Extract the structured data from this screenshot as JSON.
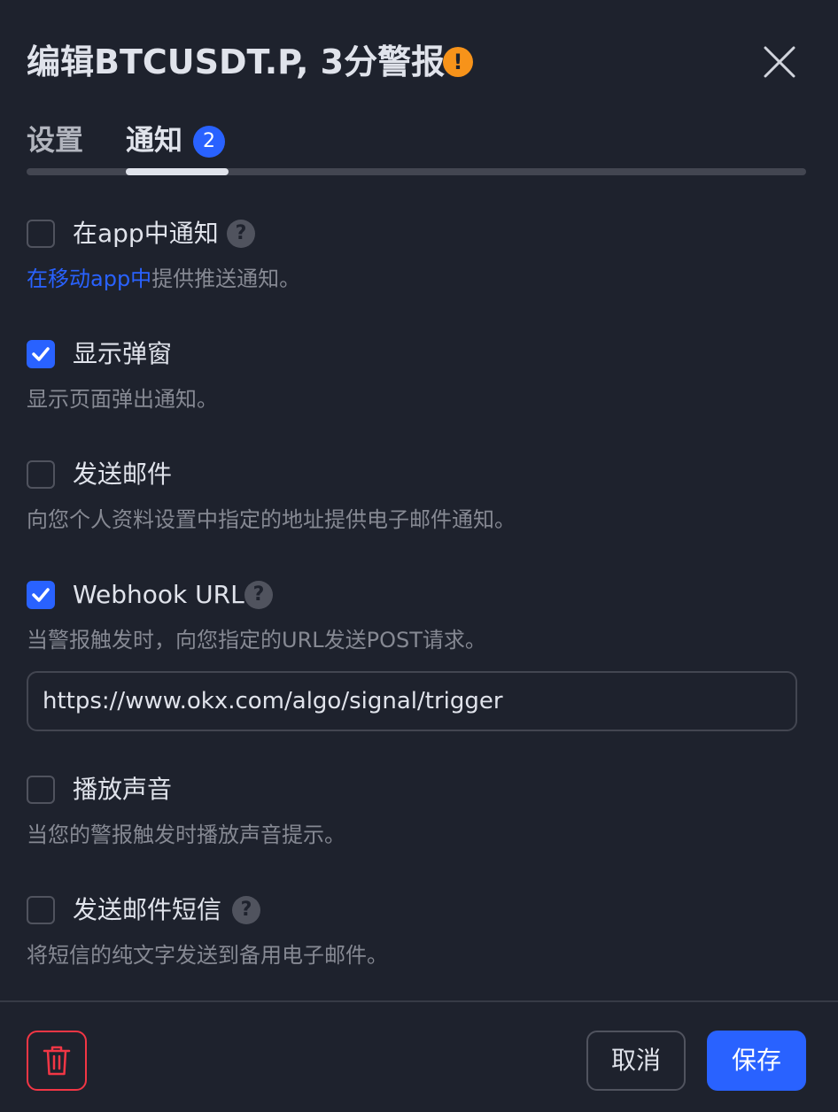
{
  "header": {
    "title": "编辑BTCUSDT.P, 3分警报",
    "warning_icon": "exclamation-circle-icon",
    "warning_glyph": "!",
    "warning_color": "#f7931a"
  },
  "tabs": [
    {
      "label": "设置",
      "active": false
    },
    {
      "label": "通知",
      "active": true,
      "badge": "2"
    }
  ],
  "options": [
    {
      "label": "在app中通知",
      "checked": false,
      "help": true,
      "desc_link": "在移动app中",
      "desc": "提供推送通知。"
    },
    {
      "label": "显示弹窗",
      "checked": true,
      "help": false,
      "desc": "显示页面弹出通知。"
    },
    {
      "label": "发送邮件",
      "checked": false,
      "help": false,
      "desc": "向您个人资料设置中指定的地址提供电子邮件通知。"
    },
    {
      "label": "Webhook URL",
      "checked": true,
      "help": true,
      "desc": "当警报触发时，向您指定的URL发送POST请求。"
    },
    {
      "label": "播放声音",
      "checked": false,
      "help": false,
      "desc": "当您的警报触发时播放声音提示。"
    },
    {
      "label": "发送邮件短信",
      "checked": false,
      "help": true,
      "desc": "将短信的纯文字发送到备用电子邮件。"
    }
  ],
  "help_glyph": "?",
  "webhook": {
    "value": "https://www.okx.com/algo/signal/trigger"
  },
  "footer": {
    "cancel_label": "取消",
    "save_label": "保存"
  },
  "colors": {
    "accent": "#2962ff",
    "background": "#1e222d",
    "danger": "#f23645",
    "warning": "#f7931a"
  }
}
